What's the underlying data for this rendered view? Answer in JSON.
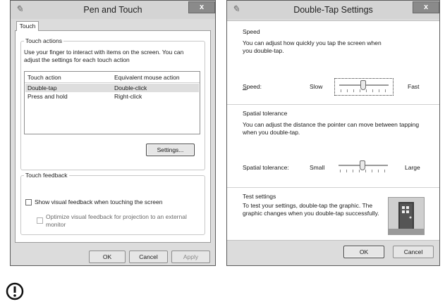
{
  "pen_touch": {
    "title": "Pen and Touch",
    "close_glyph": "x",
    "tab": "Touch",
    "touch_actions": {
      "group_title": "Touch actions",
      "description": "Use your finger to interact with items on the screen. You can adjust the settings for each touch action",
      "columns": [
        "Touch action",
        "Equivalent mouse action"
      ],
      "rows": [
        {
          "action": "Double-tap",
          "mouse": "Double-click"
        },
        {
          "action": "Press and hold",
          "mouse": "Right-click"
        }
      ],
      "settings_button": "Settings..."
    },
    "touch_feedback": {
      "group_title": "Touch feedback",
      "show_visual": "Show visual feedback when touching the screen",
      "optimize": "Optimize visual feedback for projection to an external monitor",
      "show_visual_checked": false,
      "optimize_checked": false
    },
    "buttons": {
      "ok": "OK",
      "cancel": "Cancel",
      "apply": "Apply"
    }
  },
  "double_tap": {
    "title": "Double-Tap Settings",
    "close_glyph": "x",
    "speed": {
      "group_title": "Speed",
      "description": "You can adjust how quickly you tap the screen when you double-tap.",
      "label": "Speed:",
      "min_label": "Slow",
      "max_label": "Fast",
      "value": 0.5
    },
    "tolerance": {
      "group_title": "Spatial tolerance",
      "description": "You can adjust the distance the pointer can move between tapping when you double-tap.",
      "label": "Spatial tolerance:",
      "min_label": "Small",
      "max_label": "Large",
      "value": 0.5
    },
    "test": {
      "group_title": "Test settings",
      "description": "To test your settings, double-tap the graphic. The graphic changes when you double-tap successfully."
    },
    "buttons": {
      "ok": "OK",
      "cancel": "Cancel"
    }
  },
  "note_icon": "caution-icon"
}
